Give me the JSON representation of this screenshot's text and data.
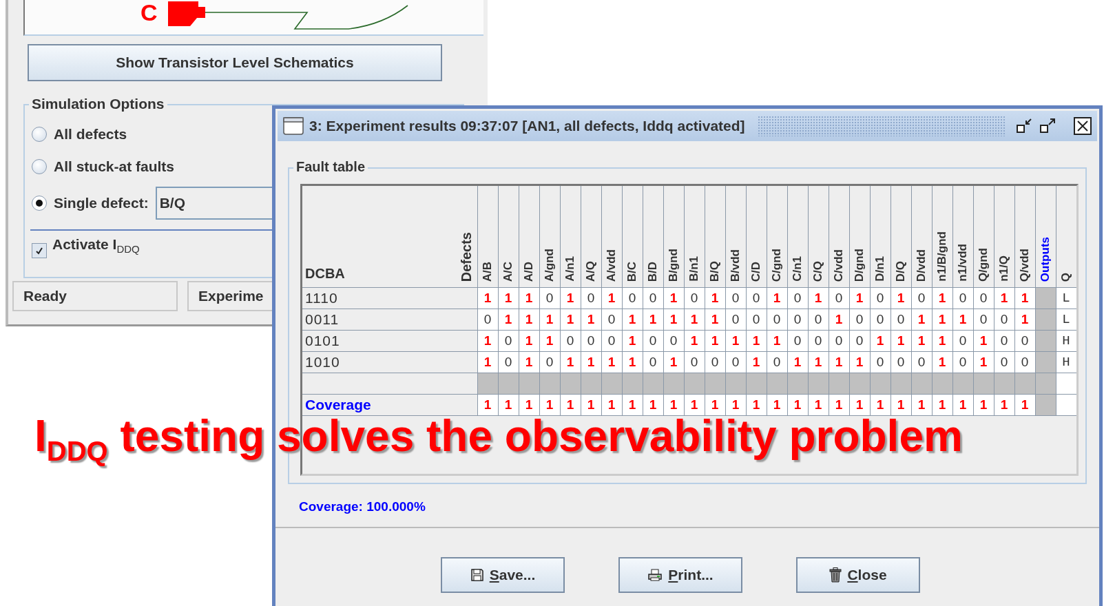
{
  "headline": "I$_{DDQ}$ testing solves the observability problem",
  "main_window": {
    "schematic": {
      "pin_label": "C"
    },
    "show_schematics_button": "Show Transistor Level Schematics",
    "simulation_options": {
      "title": "Simulation Options",
      "options": [
        {
          "label": "All defects",
          "selected": false
        },
        {
          "label": "All stuck-at faults",
          "selected": false
        },
        {
          "label": "Single defect:",
          "selected": true
        }
      ],
      "single_defect_value": "B/Q",
      "activate_iddq": {
        "label": "Activate I$_{DDQ}$",
        "checked": true
      }
    },
    "status_bar": [
      "Ready",
      "Experime"
    ]
  },
  "results_window": {
    "title": "3: Experiment results 09:37:07 [AN1, all defects, Iddq activated]",
    "fault_table": {
      "title": "Fault table",
      "row_header": "DCBA",
      "defects_header": "Defects",
      "defects": [
        "A/B",
        "A/C",
        "A/D",
        "A/gnd",
        "A/n1",
        "A/Q",
        "A/vdd",
        "B/C",
        "B/D",
        "B/gnd",
        "B/n1",
        "B/Q",
        "B/vdd",
        "C/D",
        "C/gnd",
        "C/n1",
        "C/Q",
        "C/vdd",
        "D/gnd",
        "D/n1",
        "D/Q",
        "D/vdd",
        "n1/B/gnd",
        "n1/vdd",
        "Q/gnd",
        "n1/Q",
        "Q/vdd"
      ],
      "outputs_header": "Outputs",
      "outputs": [
        "Q"
      ],
      "rows": [
        {
          "inputs": "1110",
          "outputs": [
            "L"
          ],
          "cells": [
            {
              "v": "1",
              "hit": true
            },
            {
              "v": "1",
              "hit": true
            },
            {
              "v": "1",
              "hit": true
            },
            {
              "v": "0",
              "hit": false
            },
            {
              "v": "1",
              "hit": true
            },
            {
              "v": "0",
              "hit": false
            },
            {
              "v": "1",
              "hit": true
            },
            {
              "v": "0",
              "hit": false
            },
            {
              "v": "0",
              "hit": false
            },
            {
              "v": "1",
              "hit": true
            },
            {
              "v": "0",
              "hit": false
            },
            {
              "v": "1",
              "hit": true
            },
            {
              "v": "0",
              "hit": false
            },
            {
              "v": "0",
              "hit": false
            },
            {
              "v": "1",
              "hit": true
            },
            {
              "v": "0",
              "hit": false
            },
            {
              "v": "1",
              "hit": true
            },
            {
              "v": "0",
              "hit": false
            },
            {
              "v": "1",
              "hit": true
            },
            {
              "v": "0",
              "hit": false
            },
            {
              "v": "1",
              "hit": true
            },
            {
              "v": "0",
              "hit": false
            },
            {
              "v": "1",
              "hit": true
            },
            {
              "v": "0",
              "hit": false
            },
            {
              "v": "0",
              "hit": false
            },
            {
              "v": "1",
              "hit": true
            },
            {
              "v": "1",
              "hit": true
            }
          ]
        },
        {
          "inputs": "0011",
          "outputs": [
            "L"
          ],
          "cells": [
            {
              "v": "0",
              "hit": false
            },
            {
              "v": "1",
              "hit": true
            },
            {
              "v": "1",
              "hit": true
            },
            {
              "v": "1",
              "hit": true
            },
            {
              "v": "1",
              "hit": true
            },
            {
              "v": "1",
              "hit": true
            },
            {
              "v": "0",
              "hit": false
            },
            {
              "v": "1",
              "hit": true
            },
            {
              "v": "1",
              "hit": true
            },
            {
              "v": "1",
              "hit": true
            },
            {
              "v": "1",
              "hit": true
            },
            {
              "v": "1",
              "hit": true
            },
            {
              "v": "0",
              "hit": false
            },
            {
              "v": "0",
              "hit": false
            },
            {
              "v": "0",
              "hit": false
            },
            {
              "v": "0",
              "hit": false
            },
            {
              "v": "0",
              "hit": false
            },
            {
              "v": "1",
              "hit": true
            },
            {
              "v": "0",
              "hit": false
            },
            {
              "v": "0",
              "hit": false
            },
            {
              "v": "0",
              "hit": false
            },
            {
              "v": "1",
              "hit": true
            },
            {
              "v": "1",
              "hit": true
            },
            {
              "v": "1",
              "hit": true
            },
            {
              "v": "0",
              "hit": false
            },
            {
              "v": "0",
              "hit": false
            },
            {
              "v": "1",
              "hit": true
            }
          ]
        },
        {
          "inputs": "0101",
          "outputs": [
            "H"
          ],
          "cells": [
            {
              "v": "1",
              "hit": true
            },
            {
              "v": "0",
              "hit": false
            },
            {
              "v": "1",
              "hit": true
            },
            {
              "v": "1",
              "hit": true
            },
            {
              "v": "0",
              "hit": false
            },
            {
              "v": "0",
              "hit": false
            },
            {
              "v": "0",
              "hit": false
            },
            {
              "v": "1",
              "hit": true
            },
            {
              "v": "0",
              "hit": false
            },
            {
              "v": "0",
              "hit": false
            },
            {
              "v": "1",
              "hit": true
            },
            {
              "v": "1",
              "hit": true
            },
            {
              "v": "1",
              "hit": true
            },
            {
              "v": "1",
              "hit": true
            },
            {
              "v": "1",
              "hit": true
            },
            {
              "v": "0",
              "hit": false
            },
            {
              "v": "0",
              "hit": false
            },
            {
              "v": "0",
              "hit": false
            },
            {
              "v": "0",
              "hit": false
            },
            {
              "v": "1",
              "hit": true
            },
            {
              "v": "1",
              "hit": true
            },
            {
              "v": "1",
              "hit": true
            },
            {
              "v": "1",
              "hit": true
            },
            {
              "v": "0",
              "hit": false
            },
            {
              "v": "1",
              "hit": true
            },
            {
              "v": "0",
              "hit": false
            },
            {
              "v": "0",
              "hit": false
            }
          ]
        },
        {
          "inputs": "1010",
          "outputs": [
            "H"
          ],
          "cells": [
            {
              "v": "1",
              "hit": true
            },
            {
              "v": "0",
              "hit": false
            },
            {
              "v": "1",
              "hit": true
            },
            {
              "v": "0",
              "hit": false
            },
            {
              "v": "1",
              "hit": true
            },
            {
              "v": "1",
              "hit": true
            },
            {
              "v": "1",
              "hit": true
            },
            {
              "v": "1",
              "hit": true
            },
            {
              "v": "0",
              "hit": false
            },
            {
              "v": "1",
              "hit": true
            },
            {
              "v": "0",
              "hit": false
            },
            {
              "v": "0",
              "hit": false
            },
            {
              "v": "0",
              "hit": false
            },
            {
              "v": "1",
              "hit": true
            },
            {
              "v": "0",
              "hit": false
            },
            {
              "v": "1",
              "hit": true
            },
            {
              "v": "1",
              "hit": true
            },
            {
              "v": "1",
              "hit": true
            },
            {
              "v": "1",
              "hit": true
            },
            {
              "v": "0",
              "hit": false
            },
            {
              "v": "0",
              "hit": false
            },
            {
              "v": "0",
              "hit": false
            },
            {
              "v": "1",
              "hit": true
            },
            {
              "v": "0",
              "hit": false
            },
            {
              "v": "1",
              "hit": true
            },
            {
              "v": "0",
              "hit": false
            },
            {
              "v": "0",
              "hit": false
            }
          ]
        }
      ],
      "coverage": {
        "label": "Coverage",
        "cells": [
          {
            "v": "1",
            "hit": true
          },
          {
            "v": "1",
            "hit": true
          },
          {
            "v": "1",
            "hit": true
          },
          {
            "v": "1",
            "hit": true
          },
          {
            "v": "1",
            "hit": true
          },
          {
            "v": "1",
            "hit": true
          },
          {
            "v": "1",
            "hit": true
          },
          {
            "v": "1",
            "hit": true
          },
          {
            "v": "1",
            "hit": true
          },
          {
            "v": "1",
            "hit": true
          },
          {
            "v": "1",
            "hit": true
          },
          {
            "v": "1",
            "hit": true
          },
          {
            "v": "1",
            "hit": true
          },
          {
            "v": "1",
            "hit": true
          },
          {
            "v": "1",
            "hit": true
          },
          {
            "v": "1",
            "hit": true
          },
          {
            "v": "1",
            "hit": true
          },
          {
            "v": "1",
            "hit": true
          },
          {
            "v": "1",
            "hit": true
          },
          {
            "v": "1",
            "hit": true
          },
          {
            "v": "1",
            "hit": true
          },
          {
            "v": "1",
            "hit": true
          },
          {
            "v": "1",
            "hit": true
          },
          {
            "v": "1",
            "hit": true
          },
          {
            "v": "1",
            "hit": true
          },
          {
            "v": "1",
            "hit": true
          },
          {
            "v": "1",
            "hit": true
          }
        ]
      }
    },
    "coverage_text": "Coverage: 100.000%",
    "buttons": [
      {
        "label": "Save...",
        "kind": "save"
      },
      {
        "label": "Print...",
        "kind": "print"
      },
      {
        "label": "Close",
        "kind": "close"
      }
    ]
  }
}
